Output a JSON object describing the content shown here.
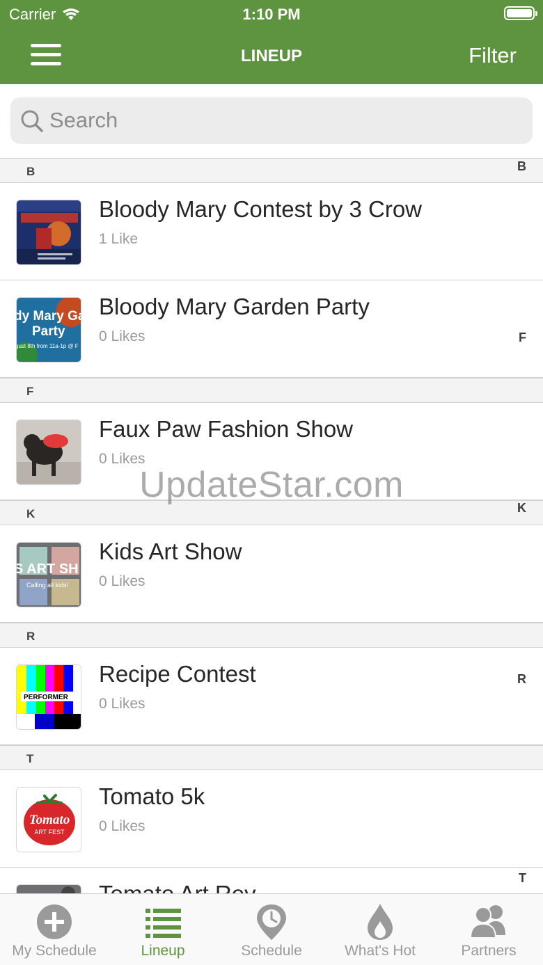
{
  "status_bar": {
    "carrier": "Carrier",
    "time": "1:10 PM"
  },
  "nav": {
    "title": "LINEUP",
    "filter_label": "Filter"
  },
  "search": {
    "placeholder": "Search"
  },
  "sections": [
    {
      "letter": "B",
      "items": [
        {
          "title": "Bloody Mary Contest by 3 Crow",
          "likes": "1 Like",
          "thumb": "bloody-mary-contest-poster"
        },
        {
          "title": "Bloody Mary Garden Party",
          "likes": "0 Likes",
          "thumb": "bloody-mary-garden-party-poster",
          "thumb_text": [
            "dy Mary Ga",
            "Party",
            "gust 8th from 11a-1p @ F"
          ]
        }
      ]
    },
    {
      "letter": "F",
      "items": [
        {
          "title": "Faux Paw Fashion Show",
          "likes": "0 Likes",
          "thumb": "dog-in-costume-photo"
        }
      ]
    },
    {
      "letter": "K",
      "items": [
        {
          "title": "Kids Art Show",
          "likes": "0 Likes",
          "thumb": "kids-art-show-photo",
          "thumb_text": [
            "S ART SH",
            "Calling all kids!"
          ]
        }
      ]
    },
    {
      "letter": "R",
      "items": [
        {
          "title": "Recipe Contest",
          "likes": "0 Likes",
          "thumb": "color-bars-performer",
          "thumb_text": [
            "PERFORMER"
          ]
        }
      ]
    },
    {
      "letter": "T",
      "items": [
        {
          "title": "Tomato 5k",
          "likes": "0 Likes",
          "thumb": "tomato-art-fest-logo",
          "thumb_text": [
            "Tomato",
            "ART FEST"
          ]
        },
        {
          "title": "Tomato Art Rev...",
          "likes": "",
          "thumb": "partial-item"
        }
      ]
    }
  ],
  "index_letters": [
    "B",
    "F",
    "K",
    "R",
    "T"
  ],
  "watermark": "UpdateStar.com",
  "tabs": [
    {
      "label": "My Schedule",
      "icon": "plus-circle-icon"
    },
    {
      "label": "Lineup",
      "icon": "list-icon"
    },
    {
      "label": "Schedule",
      "icon": "map-pin-clock-icon"
    },
    {
      "label": "What's Hot",
      "icon": "flame-drop-icon"
    },
    {
      "label": "Partners",
      "icon": "people-icon"
    }
  ],
  "colors": {
    "brand_green": "#5e9440",
    "inactive_gray": "#9a9a9a"
  }
}
